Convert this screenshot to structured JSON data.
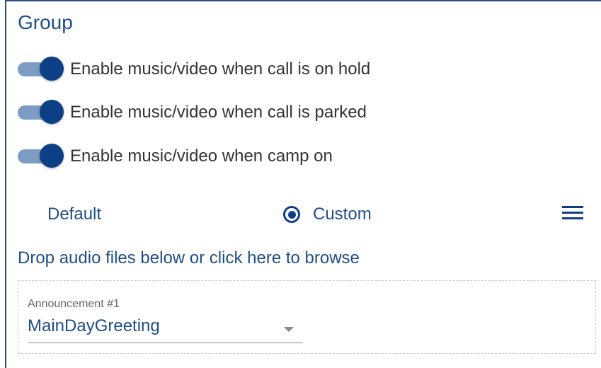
{
  "group": {
    "title": "Group",
    "toggles": [
      {
        "label": "Enable music/video when call is on hold",
        "on": true
      },
      {
        "label": "Enable music/video when call is parked",
        "on": true
      },
      {
        "label": "Enable music/video when camp on",
        "on": true
      }
    ],
    "mode": {
      "default_label": "Default",
      "custom_label": "Custom",
      "selected": "Custom"
    },
    "menu_icon": "hamburger-menu-icon",
    "drop_link": "Drop audio files below or click here to browse",
    "announcement": {
      "label": "Announcement #1",
      "value": "MainDayGreeting"
    }
  },
  "colors": {
    "primary": "#0d3f86",
    "text_blue": "#1f4e86",
    "track": "#7d9cc4",
    "body_text": "#333333"
  }
}
